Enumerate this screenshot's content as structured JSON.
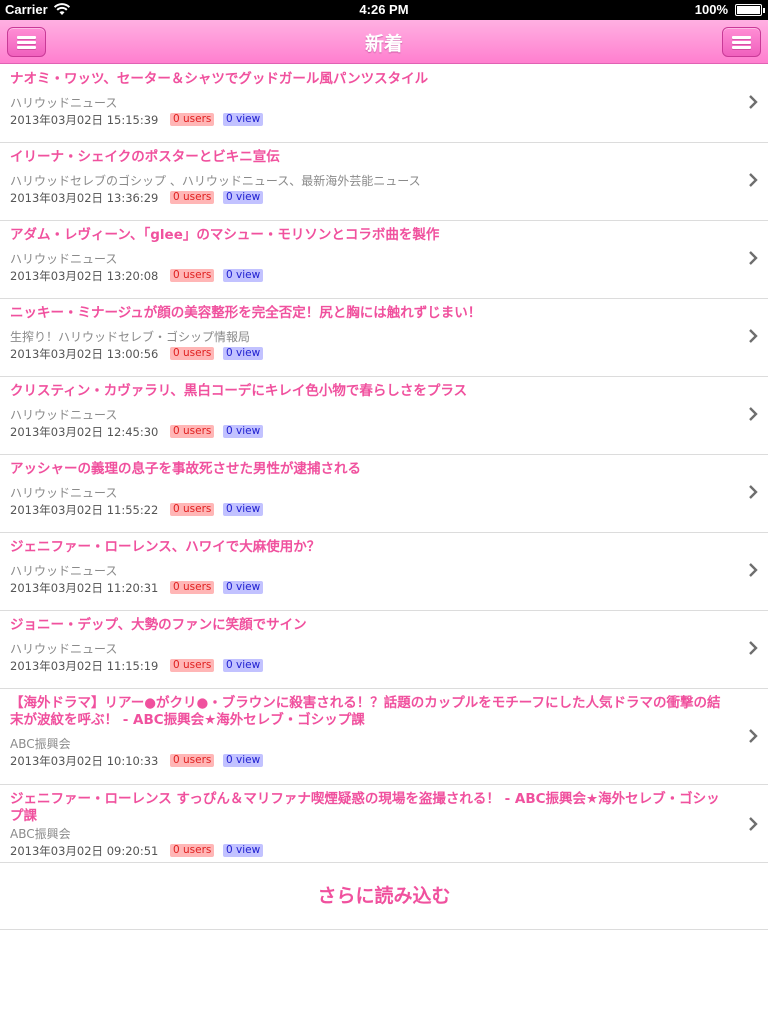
{
  "status_bar": {
    "carrier": "Carrier",
    "time": "4:26 PM",
    "battery": "100%"
  },
  "nav": {
    "title": "新着",
    "left_icon": "menu-icon",
    "right_icon": "menu-icon"
  },
  "colors": {
    "accent": "#f0519e",
    "nav_top": "#ffb0e2",
    "nav_bottom": "#ff7fcf",
    "users_badge_bg": "#ffb6b6",
    "view_badge_bg": "#c2c2ff"
  },
  "articles": [
    {
      "headline": "ナオミ・ワッツ、セーター＆シャツでグッドガール風パンツスタイル",
      "source": "ハリウッドニュース",
      "date": "2013年03月02日 15:15:39",
      "users": "0 users",
      "views": "0 view"
    },
    {
      "headline": "イリーナ・シェイクのポスターとビキニ宣伝",
      "source": "ハリウッドセレブのゴシップ 、ハリウッドニュース、最新海外芸能ニュース",
      "date": "2013年03月02日 13:36:29",
      "users": "0 users",
      "views": "0 view"
    },
    {
      "headline": "アダム・レヴィーン、「glee」のマシュー・モリソンとコラボ曲を製作",
      "source": "ハリウッドニュース",
      "date": "2013年03月02日 13:20:08",
      "users": "0 users",
      "views": "0 view"
    },
    {
      "headline": "ニッキー・ミナージュが顔の美容整形を完全否定！尻と胸には触れずじまい！",
      "source": "生搾り！ハリウッドセレブ・ゴシップ情報局",
      "date": "2013年03月02日 13:00:56",
      "users": "0 users",
      "views": "0 view"
    },
    {
      "headline": "クリスティン・カヴァラリ、黒白コーデにキレイ色小物で春らしさをプラス",
      "source": "ハリウッドニュース",
      "date": "2013年03月02日 12:45:30",
      "users": "0 users",
      "views": "0 view"
    },
    {
      "headline": "アッシャーの義理の息子を事故死させた男性が逮捕される",
      "source": "ハリウッドニュース",
      "date": "2013年03月02日 11:55:22",
      "users": "0 users",
      "views": "0 view"
    },
    {
      "headline": "ジェニファー・ローレンス、ハワイで大麻使用か？",
      "source": "ハリウッドニュース",
      "date": "2013年03月02日 11:20:31",
      "users": "0 users",
      "views": "0 view"
    },
    {
      "headline": "ジョニー・デップ、大勢のファンに笑顔でサイン",
      "source": "ハリウッドニュース",
      "date": "2013年03月02日 11:15:19",
      "users": "0 users",
      "views": "0 view"
    },
    {
      "headline": "【海外ドラマ】リアー●がクリ●・ブラウンに殺害される！？話題のカップルをモチーフにした人気ドラマの衝撃の結末が波紋を呼ぶ！ - ABC振興会★海外セレブ・ゴシップ課",
      "source": "ABC振興会",
      "date": "2013年03月02日 10:10:33",
      "users": "0 users",
      "views": "0 view"
    },
    {
      "headline": "ジェニファー・ローレンス すっぴん＆マリファナ喫煙疑惑の現場を盗撮される！ - ABC振興会★海外セレブ・ゴシップ課",
      "source": "ABC振興会",
      "date": "2013年03月02日 09:20:51",
      "users": "0 users",
      "views": "0 view"
    }
  ],
  "load_more": "さらに読み込む"
}
